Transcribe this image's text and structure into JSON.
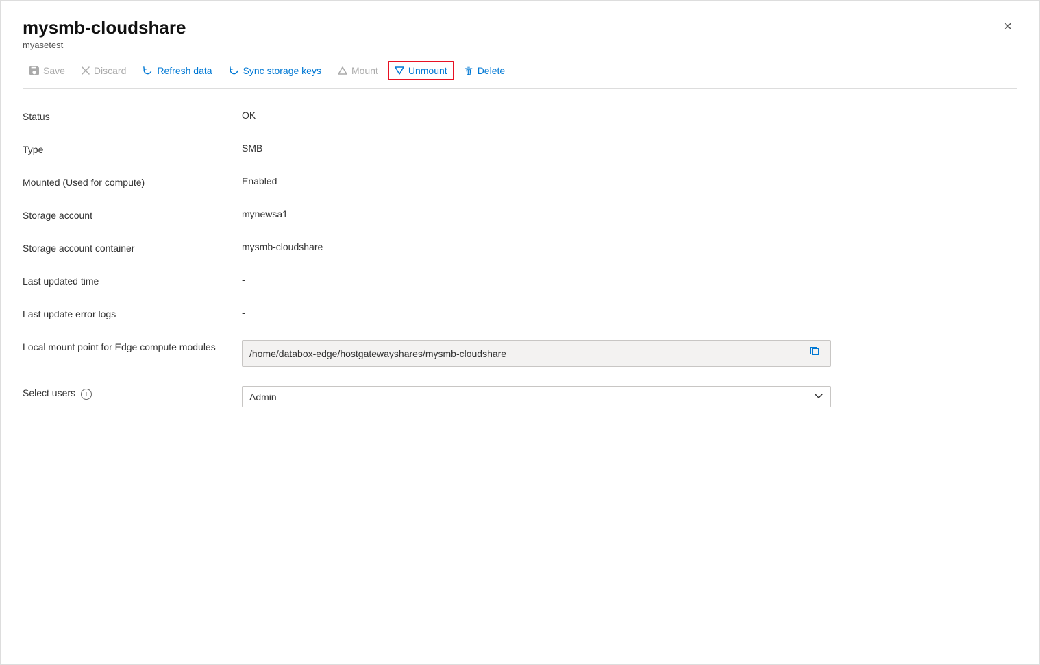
{
  "panel": {
    "title": "mysmb-cloudshare",
    "subtitle": "myasetest",
    "close_label": "×"
  },
  "toolbar": {
    "save_label": "Save",
    "discard_label": "Discard",
    "refresh_label": "Refresh data",
    "sync_label": "Sync storage keys",
    "mount_label": "Mount",
    "unmount_label": "Unmount",
    "delete_label": "Delete"
  },
  "fields": [
    {
      "label": "Status",
      "value": "OK",
      "type": "text"
    },
    {
      "label": "Type",
      "value": "SMB",
      "type": "text"
    },
    {
      "label": "Mounted (Used for compute)",
      "value": "Enabled",
      "type": "text"
    },
    {
      "label": "Storage account",
      "value": "mynewsa1",
      "type": "text"
    },
    {
      "label": "Storage account container",
      "value": "mysmb-cloudshare",
      "type": "text"
    },
    {
      "label": "Last updated time",
      "value": "-",
      "type": "text"
    },
    {
      "label": "Last update error logs",
      "value": "-",
      "type": "text"
    },
    {
      "label": "Local mount point for Edge compute modules",
      "value": "/home/databox-edge/hostgatewayshares/mysmb-cloudshare",
      "type": "readonly-input"
    },
    {
      "label": "Select users",
      "value": "Admin",
      "type": "select",
      "has_info": true
    }
  ],
  "colors": {
    "accent": "#0078d4",
    "highlight_border": "#e81123",
    "disabled": "#aaa"
  }
}
